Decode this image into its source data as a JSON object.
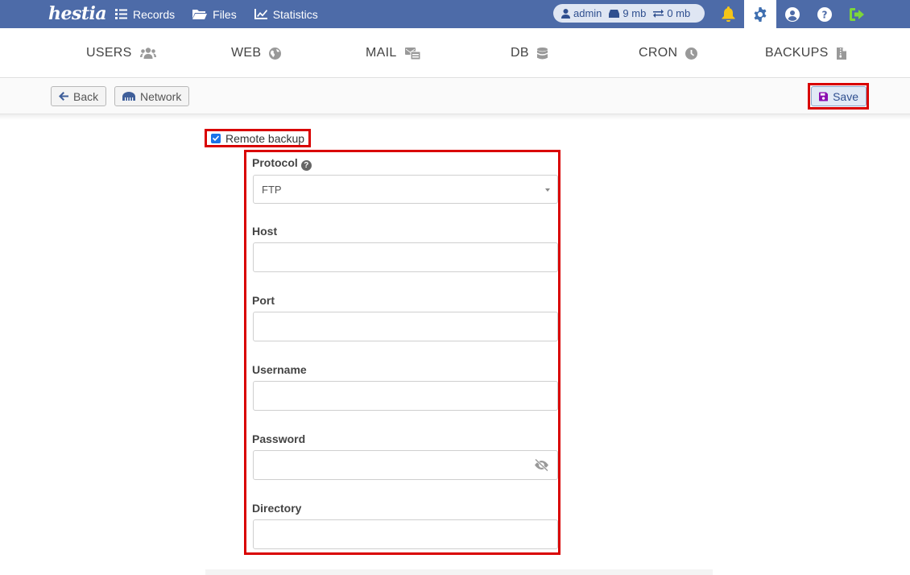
{
  "app": {
    "logo_text": "hestia"
  },
  "topnav": [
    {
      "label": "Records",
      "icon": "list-icon"
    },
    {
      "label": "Files",
      "icon": "folder-icon"
    },
    {
      "label": "Statistics",
      "icon": "chart-icon"
    }
  ],
  "stats": {
    "user": "admin",
    "disk": "9 mb",
    "bandwidth": "0 mb"
  },
  "top_icons": [
    "bell-icon",
    "gear-icon",
    "user-circle-icon",
    "help-icon",
    "logout-icon"
  ],
  "tabs": [
    {
      "label": "USERS",
      "icon": "users-icon"
    },
    {
      "label": "WEB",
      "icon": "globe-icon"
    },
    {
      "label": "MAIL",
      "icon": "mail-icon"
    },
    {
      "label": "DB",
      "icon": "database-icon"
    },
    {
      "label": "CRON",
      "icon": "clock-icon"
    },
    {
      "label": "BACKUPS",
      "icon": "file-archive-icon"
    }
  ],
  "toolbar": {
    "back_label": "Back",
    "network_label": "Network",
    "save_label": "Save"
  },
  "form": {
    "remote_backup_label": "Remote backup",
    "remote_backup_checked": true,
    "protocol_label": "Protocol",
    "protocol_value": "FTP",
    "host_label": "Host",
    "host_value": "",
    "port_label": "Port",
    "port_value": "",
    "username_label": "Username",
    "username_value": "",
    "password_label": "Password",
    "password_value": "",
    "directory_label": "Directory",
    "directory_value": ""
  },
  "colors": {
    "topbar": "#4d6ba8",
    "highlight": "#d90000",
    "save_icon": "#8a0fb0"
  }
}
